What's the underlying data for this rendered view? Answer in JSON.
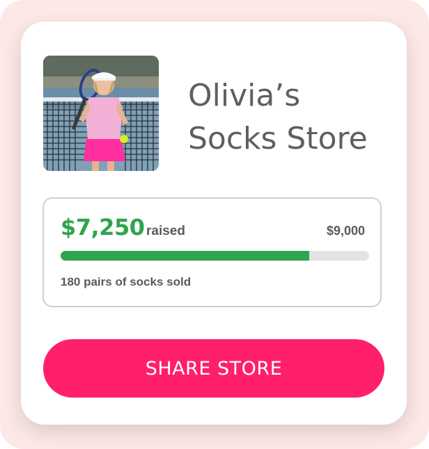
{
  "store": {
    "title": "Olivia’s Socks Store",
    "photo": "girl-with-tennis-racket-photo"
  },
  "fundraising": {
    "raised_amount": "$7,250",
    "raised_label": "raised",
    "goal_amount": "$9,000",
    "progress_fraction": 0.8056,
    "sold_text": "180 pairs of socks sold"
  },
  "actions": {
    "share_label": "SHARE STORE"
  },
  "colors": {
    "accent_green": "#2fa44f",
    "button_pink": "#ff1f6b",
    "frame_pink": "#fde8e8",
    "text_gray": "#5f5f5f"
  }
}
